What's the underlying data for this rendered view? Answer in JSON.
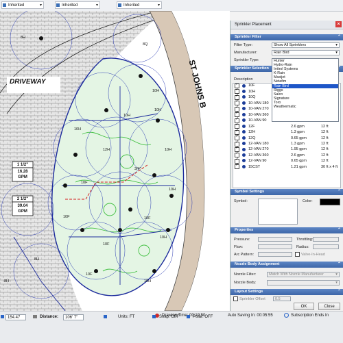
{
  "toolbar": {
    "dropdowns": [
      {
        "value": "Inherited"
      },
      {
        "value": "Inherited"
      },
      {
        "value": "Inherited"
      }
    ]
  },
  "drawing": {
    "street_label": "ST JOHNS B",
    "driveway_label": "DRIVEWAY",
    "pipe_labels": [
      {
        "size": "1 1/2\"",
        "flow": "16.28",
        "unit": "GPM"
      },
      {
        "size": "2 1/2\"",
        "flow": "39.04",
        "unit": "GPM"
      }
    ],
    "head_labels": [
      "8H",
      "8Q",
      "10H",
      "10H",
      "10H",
      "10H",
      "10H",
      "10H",
      "12H",
      "10F",
      "10F",
      "10F",
      "10F",
      "10F",
      "10H",
      "3/4\"",
      "8H",
      "8H",
      "10H"
    ]
  },
  "panel": {
    "title": "Sprinkler Placement",
    "close_icon": "close-icon",
    "sections": {
      "filter": "Sprinkler Filter",
      "selection": "Sprinkler Selection",
      "symbol": "Symbol Settings",
      "properties": "Properties",
      "nozzle": "Nozzle Body Assignment",
      "layout": "Layout Settings"
    },
    "filter_type_label": "Filter Type:",
    "filter_type_value": "Show All Sprinklers",
    "manufacturer_label": "Manufacturer:",
    "manufacturer_value": "Rain Bird",
    "sprinkler_type_label": "Sprinkler Type:",
    "manufacturer_options": [
      "Hunter",
      "Hydro-Rain",
      "Irritrol Systems",
      "K-Rain",
      "Maxijet",
      "Netafim",
      "Rain Bird",
      "Riggs",
      "Salco",
      "Signature",
      "Toro",
      "Weathermatic"
    ],
    "selected_option": "Rain Bird",
    "table_header": "Description",
    "rows": [
      {
        "desc": "10F",
        "flow": "",
        "radius": ""
      },
      {
        "desc": "10H",
        "flow": "",
        "radius": ""
      },
      {
        "desc": "10Q",
        "flow": "",
        "radius": ""
      },
      {
        "desc": "10-VAN 180",
        "flow": "2.6 gpm",
        "radius": "10 ft"
      },
      {
        "desc": "10-VAN 270",
        "flow": "1.96 gpm",
        "radius": "10 ft"
      },
      {
        "desc": "10-VAN 360",
        "flow": "2.6 gpm",
        "radius": "10 ft"
      },
      {
        "desc": "10-VAN 90",
        "flow": "0.75 gpm",
        "radius": "10 ft"
      },
      {
        "desc": "12F",
        "flow": "2.6 gpm",
        "radius": "12 ft"
      },
      {
        "desc": "12H",
        "flow": "1.3 gpm",
        "radius": "12 ft"
      },
      {
        "desc": "12Q",
        "flow": "0.65 gpm",
        "radius": "12 ft"
      },
      {
        "desc": "12-VAN 180",
        "flow": "1.3 gpm",
        "radius": "12 ft"
      },
      {
        "desc": "12-VAN 270",
        "flow": "1.95 gpm",
        "radius": "12 ft"
      },
      {
        "desc": "12-VAN 360",
        "flow": "2.6 gpm",
        "radius": "12 ft"
      },
      {
        "desc": "12-VAN 90",
        "flow": "0.65 gpm",
        "radius": "12 ft"
      },
      {
        "desc": "15CST",
        "flow": "1.21 gpm",
        "radius": "30 ft x 4 ft"
      }
    ],
    "symbol_label": "Symbol:",
    "color_label": "Color:",
    "pressure_label": "Pressure:",
    "throttling_label": "Throttling:",
    "flow_label": "Flow:",
    "radius_label": "Radius:",
    "arc_pattern_label": "Arc Pattern:",
    "valve_in_head_label": "Valve-In-Head",
    "nozzle_filter_label": "Nozzle Filter:",
    "nozzle_filter_value": "Match With Nozzle Manufacturer",
    "nozzle_body_label": "Nozzle Body:",
    "sprinkler_offset_label": "Sprinkler Offset",
    "sprinkler_offset_value": "0.5",
    "ok_label": "OK",
    "close_label": "Close"
  },
  "status": {
    "drawing_time": "Drawing Time: 00:19:50",
    "auto_saving": "Auto Saving In: 00:05:55",
    "subscription": "Subscription Ends In",
    "coord_value": "154.47",
    "distance_label": "Distance:",
    "distance_value": "106' 7\"",
    "units": "Units: FT",
    "snap": "Snap: OFF",
    "polar": "Polar: OFF"
  },
  "colors": {
    "panel_header": "#3d66a8",
    "selection_blue": "#1e56c8",
    "pipe_blue": "#1b2a9c",
    "lateral_red": "#d42020",
    "turf_green": "#3fbf3f",
    "lawn_fill": "#e4f5e4"
  }
}
